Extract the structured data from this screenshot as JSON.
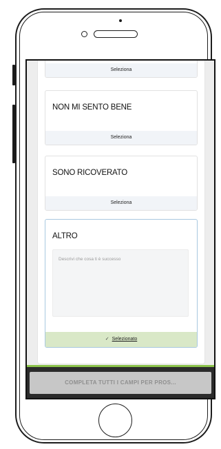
{
  "options": [
    {
      "title": "",
      "action_label": "Seleziona",
      "selected": false
    },
    {
      "title": "NON MI SENTO BENE",
      "action_label": "Seleziona",
      "selected": false
    },
    {
      "title": "SONO RICOVERATO",
      "action_label": "Seleziona",
      "selected": false
    },
    {
      "title": "ALTRO",
      "action_label": "Selezionato",
      "selected": true
    }
  ],
  "other_description": {
    "placeholder": "Descrivi che cosa ti è successo",
    "value": ""
  },
  "submit_button": {
    "label": "COMPLETA TUTTI I CAMPI PER PROS..."
  },
  "icons": {
    "selected_check": "check-icon"
  },
  "colors": {
    "selected_footer": "#d9e8c7",
    "selected_border": "#a8c8e0",
    "accent_green": "#8bc34a",
    "cta_bar": "#2b2b2b",
    "cta_button_disabled": "#c7c7c7"
  }
}
